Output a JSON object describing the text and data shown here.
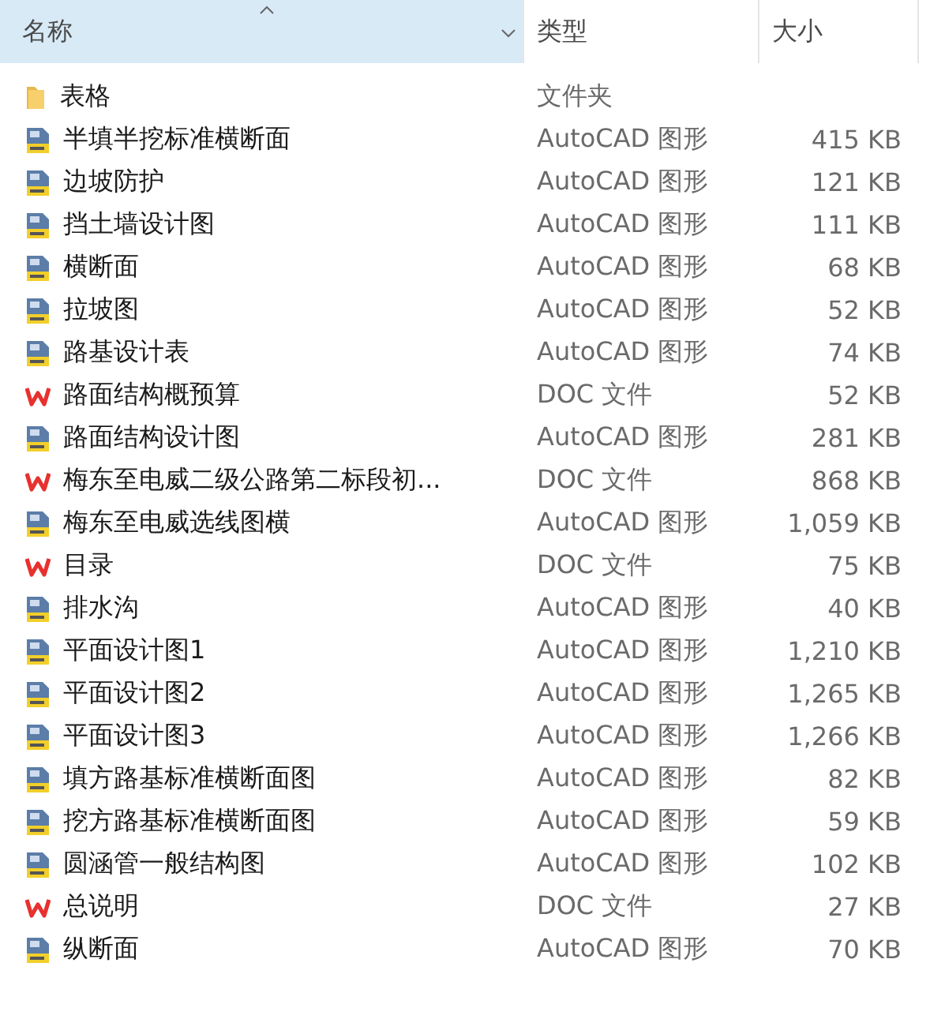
{
  "columns": [
    {
      "label": "名称",
      "selected": true
    },
    {
      "label": "类型",
      "selected": false
    },
    {
      "label": "大小",
      "selected": false
    }
  ],
  "rows": [
    {
      "kind": "folder",
      "name": "表格",
      "type": "文件夹",
      "size": ""
    },
    {
      "kind": "dwg",
      "name": "半填半挖标准横断面",
      "type": "AutoCAD 图形",
      "size": "415 KB"
    },
    {
      "kind": "dwg",
      "name": "边坡防护",
      "type": "AutoCAD 图形",
      "size": "121 KB"
    },
    {
      "kind": "dwg",
      "name": "挡土墙设计图",
      "type": "AutoCAD 图形",
      "size": "111 KB"
    },
    {
      "kind": "dwg",
      "name": "横断面",
      "type": "AutoCAD 图形",
      "size": "68 KB"
    },
    {
      "kind": "dwg",
      "name": "拉坡图",
      "type": "AutoCAD 图形",
      "size": "52 KB"
    },
    {
      "kind": "dwg",
      "name": "路基设计表",
      "type": "AutoCAD 图形",
      "size": "74 KB"
    },
    {
      "kind": "doc",
      "name": "路面结构概预算",
      "type": "DOC 文件",
      "size": "52 KB"
    },
    {
      "kind": "dwg",
      "name": "路面结构设计图",
      "type": "AutoCAD 图形",
      "size": "281 KB"
    },
    {
      "kind": "doc",
      "name": "梅东至电威二级公路第二标段初...",
      "type": "DOC 文件",
      "size": "868 KB"
    },
    {
      "kind": "dwg",
      "name": "梅东至电威选线图横",
      "type": "AutoCAD 图形",
      "size": "1,059 KB"
    },
    {
      "kind": "doc",
      "name": "目录",
      "type": "DOC 文件",
      "size": "75 KB"
    },
    {
      "kind": "dwg",
      "name": "排水沟",
      "type": "AutoCAD 图形",
      "size": "40 KB"
    },
    {
      "kind": "dwg",
      "name": "平面设计图1",
      "type": "AutoCAD 图形",
      "size": "1,210 KB"
    },
    {
      "kind": "dwg",
      "name": "平面设计图2",
      "type": "AutoCAD 图形",
      "size": "1,265 KB"
    },
    {
      "kind": "dwg",
      "name": "平面设计图3",
      "type": "AutoCAD 图形",
      "size": "1,266 KB"
    },
    {
      "kind": "dwg",
      "name": "填方路基标准横断面图",
      "type": "AutoCAD 图形",
      "size": "82 KB"
    },
    {
      "kind": "dwg",
      "name": "挖方路基标准横断面图",
      "type": "AutoCAD 图形",
      "size": "59 KB"
    },
    {
      "kind": "dwg",
      "name": "圆涵管一般结构图",
      "type": "AutoCAD 图形",
      "size": "102 KB"
    },
    {
      "kind": "doc",
      "name": "总说明",
      "type": "DOC 文件",
      "size": "27 KB"
    },
    {
      "kind": "dwg",
      "name": "纵断面",
      "type": "AutoCAD 图形",
      "size": "70 KB"
    }
  ]
}
